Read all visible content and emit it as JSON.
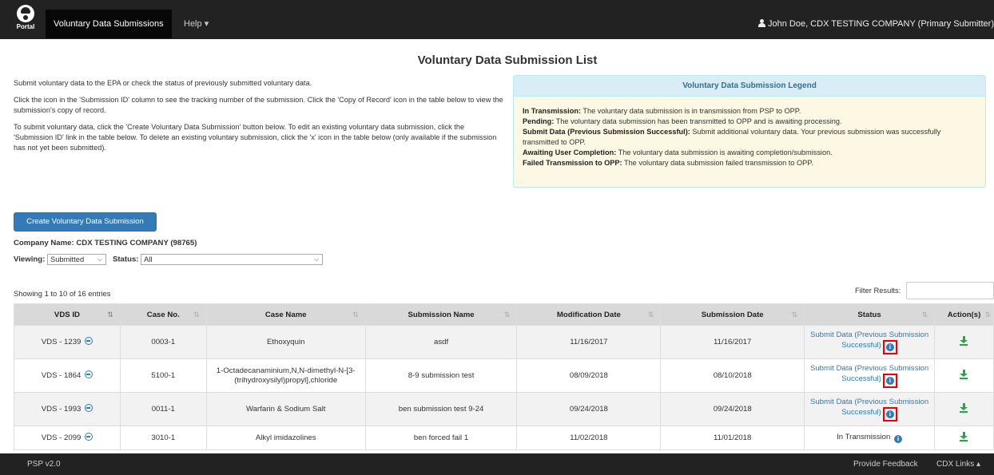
{
  "navbar": {
    "logo_text": "Portal",
    "active_item": "Voluntary Data Submissions",
    "help_label": "Help",
    "user": "John Doe, CDX TESTING COMPANY (Primary Submitter)"
  },
  "page_title": "Voluntary Data Submission List",
  "intro": {
    "p1": "Submit voluntary data to the EPA or check the status of previously submitted voluntary data.",
    "p2": "Click the icon in the 'Submission ID' column to see the tracking number of the submission. Click the 'Copy of Record' icon in the table below to view the submission's copy of record.",
    "p3": "To submit voluntary data, click the 'Create Voluntary Data Submission' button below. To edit an existing voluntary data submission, click the 'Submission ID' link in the table below. To delete an existing voluntary submission, click the 'x' icon in the table below (only available if the submission has not yet been submitted)."
  },
  "legend": {
    "title": "Voluntary Data Submission Legend",
    "items": [
      {
        "term": "In Transmission:",
        "desc": " The voluntary data submission is in transmission from PSP to OPP."
      },
      {
        "term": "Pending:",
        "desc": " The voluntary data submission has been transmitted to OPP and is awaiting processing."
      },
      {
        "term": "Submit Data (Previous Submission Successful):",
        "desc": " Submit additional voluntary data. Your previous submission was successfully transmitted to OPP."
      },
      {
        "term": "Awaiting User Completion:",
        "desc": " The voluntary data submission is awaiting completion/submission."
      },
      {
        "term": "Failed Transmission to OPP:",
        "desc": " The voluntary data submission failed transmission to OPP."
      }
    ]
  },
  "create_button": "Create Voluntary Data Submission",
  "company": "Company Name: CDX TESTING COMPANY (98765)",
  "filters": {
    "viewing_label": "Viewing:",
    "viewing_value": "Submitted",
    "status_label": "Status:",
    "status_value": "All"
  },
  "showing": "Showing 1 to 10 of 16 entries",
  "filter_label": "Filter Results:",
  "table": {
    "headers": [
      "VDS ID",
      "Case No.",
      "Case Name",
      "Submission Name",
      "Modification Date",
      "Submission Date",
      "Status",
      "Action(s)"
    ],
    "rows": [
      {
        "id": "VDS - 1239",
        "case_no": "0003-1",
        "case_name": "Ethoxyquin",
        "sub_name": "asdf",
        "mod_date": "11/16/2017",
        "sub_date": "11/16/2017",
        "status": "Submit Data (Previous Submission Successful)",
        "link": true,
        "boxed": true
      },
      {
        "id": "VDS - 1864",
        "case_no": "5100-1",
        "case_name": "1-Octadecanaminium,N,N-dimethyl-N-[3-(trihydroxysilyl)propyl],chloride",
        "sub_name": "8-9 submission test",
        "mod_date": "08/09/2018",
        "sub_date": "08/10/2018",
        "status": "Submit Data (Previous Submission Successful)",
        "link": true,
        "boxed": true
      },
      {
        "id": "VDS - 1993",
        "case_no": "0011-1",
        "case_name": "Warfarin & Sodium Salt",
        "sub_name": "ben submission test 9-24",
        "mod_date": "09/24/2018",
        "sub_date": "09/24/2018",
        "status": "Submit Data (Previous Submission Successful)",
        "link": true,
        "boxed": true
      },
      {
        "id": "VDS - 2099",
        "case_no": "3010-1",
        "case_name": "Alkyl imidazolines",
        "sub_name": "ben forced fail 1",
        "mod_date": "11/02/2018",
        "sub_date": "11/01/2018",
        "status": "In Transmission",
        "link": false,
        "boxed": false
      }
    ]
  },
  "footer": {
    "version": "PSP  v2.0",
    "feedback": "Provide Feedback",
    "cdx_links": "CDX Links"
  }
}
